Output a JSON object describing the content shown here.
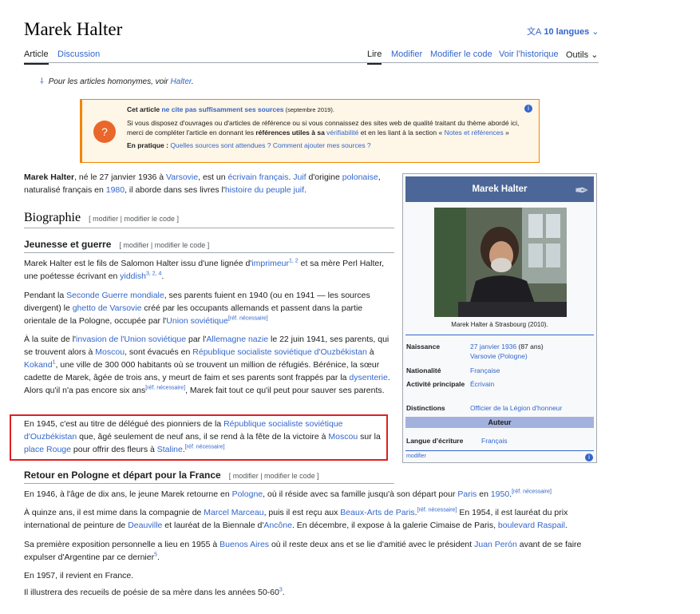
{
  "page": {
    "title": "Marek Halter",
    "languages": "10 langues",
    "lang_icon": "文A"
  },
  "tabs": {
    "article": "Article",
    "discussion": "Discussion",
    "lire": "Lire",
    "modifier": "Modifier",
    "modifier_code": "Modifier le code",
    "historique": "Voir l’historique",
    "outils": "Outils"
  },
  "hatnote": {
    "text": "Pour les articles homonymes, voir ",
    "link": "Halter",
    "end": "."
  },
  "ambox": {
    "l1_a": "Cet article ",
    "l1_link": "ne cite pas suffisamment ses sources",
    "l1_date": " (septembre 2019).",
    "l2": "Si vous disposez d'ouvrages ou d'articles de référence ou si vous connaissez des sites web de qualité traitant du thème abordé ici, merci de compléter l'article en donnant les ",
    "l2_bold": "références utiles à sa ",
    "l2_link": "vérifiabilité",
    "l2_end": " et en les liant à la section « ",
    "l2_link2": "Notes et références",
    "l2_end2": " »",
    "l3_bold": "En pratique : ",
    "l3_link": "Quelles sources sont attendues ? Comment ajouter mes sources ?"
  },
  "intro": {
    "b": "Marek Halter",
    "t1": ", né le 27 janvier 1936 à ",
    "l1": "Varsovie",
    "t2": ", est un ",
    "l2": "écrivain français",
    "t3": ". ",
    "l3": "Juif",
    "t4": " d'origine ",
    "l4": "polonaise",
    "t5": ", naturalisé français en ",
    "l5": "1980",
    "t6": ", il aborde dans ses livres l'",
    "l6": "histoire du peuple juif",
    "t7": "."
  },
  "sections": {
    "biographie": "Biographie",
    "jeunesse": "Jeunesse et guerre",
    "retour": "Retour en Pologne et départ pour la France",
    "edit": "[ modifier | modifier le code ]"
  },
  "p1": {
    "t1": "Marek Halter est le fils de Salomon Halter issu d'une lignée d'",
    "l1": "imprimeur",
    "s1": "1, 2",
    "t2": " et sa mère Perl Halter, une poétesse écrivant en ",
    "l2": "yiddish",
    "s2": "3, 2, 4",
    "t3": "."
  },
  "p2": {
    "t1": "Pendant la ",
    "l1": "Seconde Guerre mondiale",
    "t2": ", ses parents fuient en 1940 (ou en 1941 — les sources divergent) le ",
    "l2": "ghetto de Varsovie",
    "t3": " créé par les occupants allemands et passent dans la partie orientale de la Pologne, occupée par l'",
    "l3": "Union soviétique",
    "s1": "[réf. nécessaire]"
  },
  "p3": {
    "t1": "À la suite de l'",
    "l1": "invasion de l'Union soviétique",
    "t2": " par l'",
    "l2": "Allemagne nazie",
    "t3": " le 22 juin 1941, ses parents, qui se trouvent alors à ",
    "l3": "Moscou",
    "t4": ", sont évacués en ",
    "l4": "République socialiste soviétique d'Ouzbékistan",
    "t5": " à ",
    "l5": "Kokand",
    "s1": "1",
    "t6": ", une ville de 300 000 habitants où se trouvent un million de réfugiés. Bérénice, la sœur cadette de Marek, âgée de trois ans, y meurt de faim et ses parents sont frappés par la ",
    "l6": "dysenterie",
    "t7": ". Alors qu'il n'a pas encore six ans",
    "s2": "[réf. nécessaire]",
    "t8": ", Marek fait tout ce qu'il peut pour sauver ses parents."
  },
  "p4": {
    "t1": "En 1945, c'est au titre de délégué des pionniers de la ",
    "l1": "République socialiste soviétique d'Ouzbékistan",
    "t2": " que, âgé seulement de neuf ans, il se rend à la fête de la victoire à ",
    "l2": "Moscou",
    "t3": " sur la ",
    "l3": "place Rouge",
    "t4": " pour offrir des fleurs à ",
    "l4": "Staline",
    "t5": ".",
    "s1": "[réf. nécessaire]"
  },
  "p5": {
    "t1": "En 1946, à l'âge de dix ans, le jeune Marek retourne en ",
    "l1": "Pologne",
    "t2": ", où il réside avec sa famille jusqu'à son départ pour ",
    "l2": "Paris",
    "t3": " en ",
    "l3": "1950",
    "t4": ".",
    "s1": "[réf. nécessaire]"
  },
  "p6": {
    "t1": "À quinze ans, il est mime dans la compagnie de ",
    "l1": "Marcel Marceau",
    "t2": ", puis il est reçu aux ",
    "l2": "Beaux-Arts de Paris",
    "t3": ".",
    "s1": "[réf. nécessaire]",
    "t4": " En 1954, il est lauréat du prix international de peinture de ",
    "l3": "Deauville",
    "t5": " et lauréat de la Biennale d'",
    "l4": "Ancône",
    "t6": ". En décembre, il expose à la galerie Cimaise de Paris, ",
    "l5": "boulevard Raspail",
    "t7": "."
  },
  "p7": {
    "t1": "Sa première exposition personnelle a lieu en 1955 à ",
    "l1": "Buenos Aires",
    "t2": " où il reste deux ans et se lie d'amitié avec le président ",
    "l2": "Juan Perón",
    "t3": " avant de se faire expulser d'Argentine par ce dernier",
    "s1": "5",
    "t4": "."
  },
  "p8": {
    "t1": "En 1957, il revient en France."
  },
  "p9": {
    "t1": "Il illustrera des recueils de poésie de sa mère dans les années 50-60",
    "s1": "3",
    "t2": "."
  },
  "infobox": {
    "title": "Marek Halter",
    "caption": "Marek Halter à Strasbourg (2010).",
    "naissance_k": "Naissance",
    "naissance_v1": "27 janvier 1936",
    "naissance_v2": " (87 ans)",
    "naissance_v3": "Varsovie (Pologne)",
    "nationalite_k": "Nationalité",
    "nationalite_v": "Française",
    "activite_k": "Activité principale",
    "activite_v": "Écrivain",
    "distinctions_k": "Distinctions",
    "distinctions_v": "Officier de la Légion d'honneur",
    "auteur": "Auteur",
    "langue_k": "Langue d’écriture",
    "langue_v": "Français",
    "modifier": "modifier"
  }
}
